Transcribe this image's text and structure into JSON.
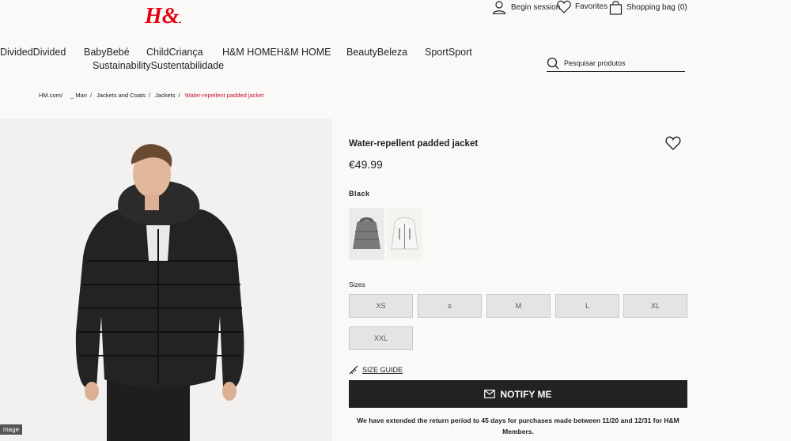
{
  "brand": {
    "logo_text": "H&M",
    "logo_color": "#e50010"
  },
  "header": {
    "signin_label": "Begin session",
    "favorites_label": "Favorites",
    "bag_label": "Shopping bag (0)"
  },
  "nav": {
    "items": [
      "DividedDivided",
      "BabyBebé",
      "ChildCriança",
      "H&M HOMEH&M HOME",
      "BeautyBeleza",
      "SportSport"
    ],
    "second_row": "SustainabilitySustentabilidade"
  },
  "search": {
    "placeholder": "Pesquisar produtos"
  },
  "breadcrumb": [
    "HM.com/",
    "_ Man",
    "Jackets and Coats",
    "Jackets",
    "Water-repellent padded jacket"
  ],
  "image": {
    "tag": "mage"
  },
  "product": {
    "title": "Water-repellent padded jacket",
    "price": "€49.99",
    "color": "Black",
    "sizes_label": "Sizes",
    "sizes": [
      "XS",
      "s",
      "M",
      "L",
      "XL",
      "XXL"
    ],
    "size_guide": "SIZE GUIDE",
    "notify_label": "NOTIFY ME",
    "note": "We have extended the return period to 45 days for purchases made between 11/20 and 12/31 for H&M Members."
  },
  "colors": {
    "accent": "#c8102e",
    "button_dark": "#222222"
  },
  "icons": [
    "user-icon",
    "heart-icon",
    "bag-icon",
    "search-icon",
    "wishlist-heart-icon",
    "ruler-icon",
    "mail-icon"
  ]
}
